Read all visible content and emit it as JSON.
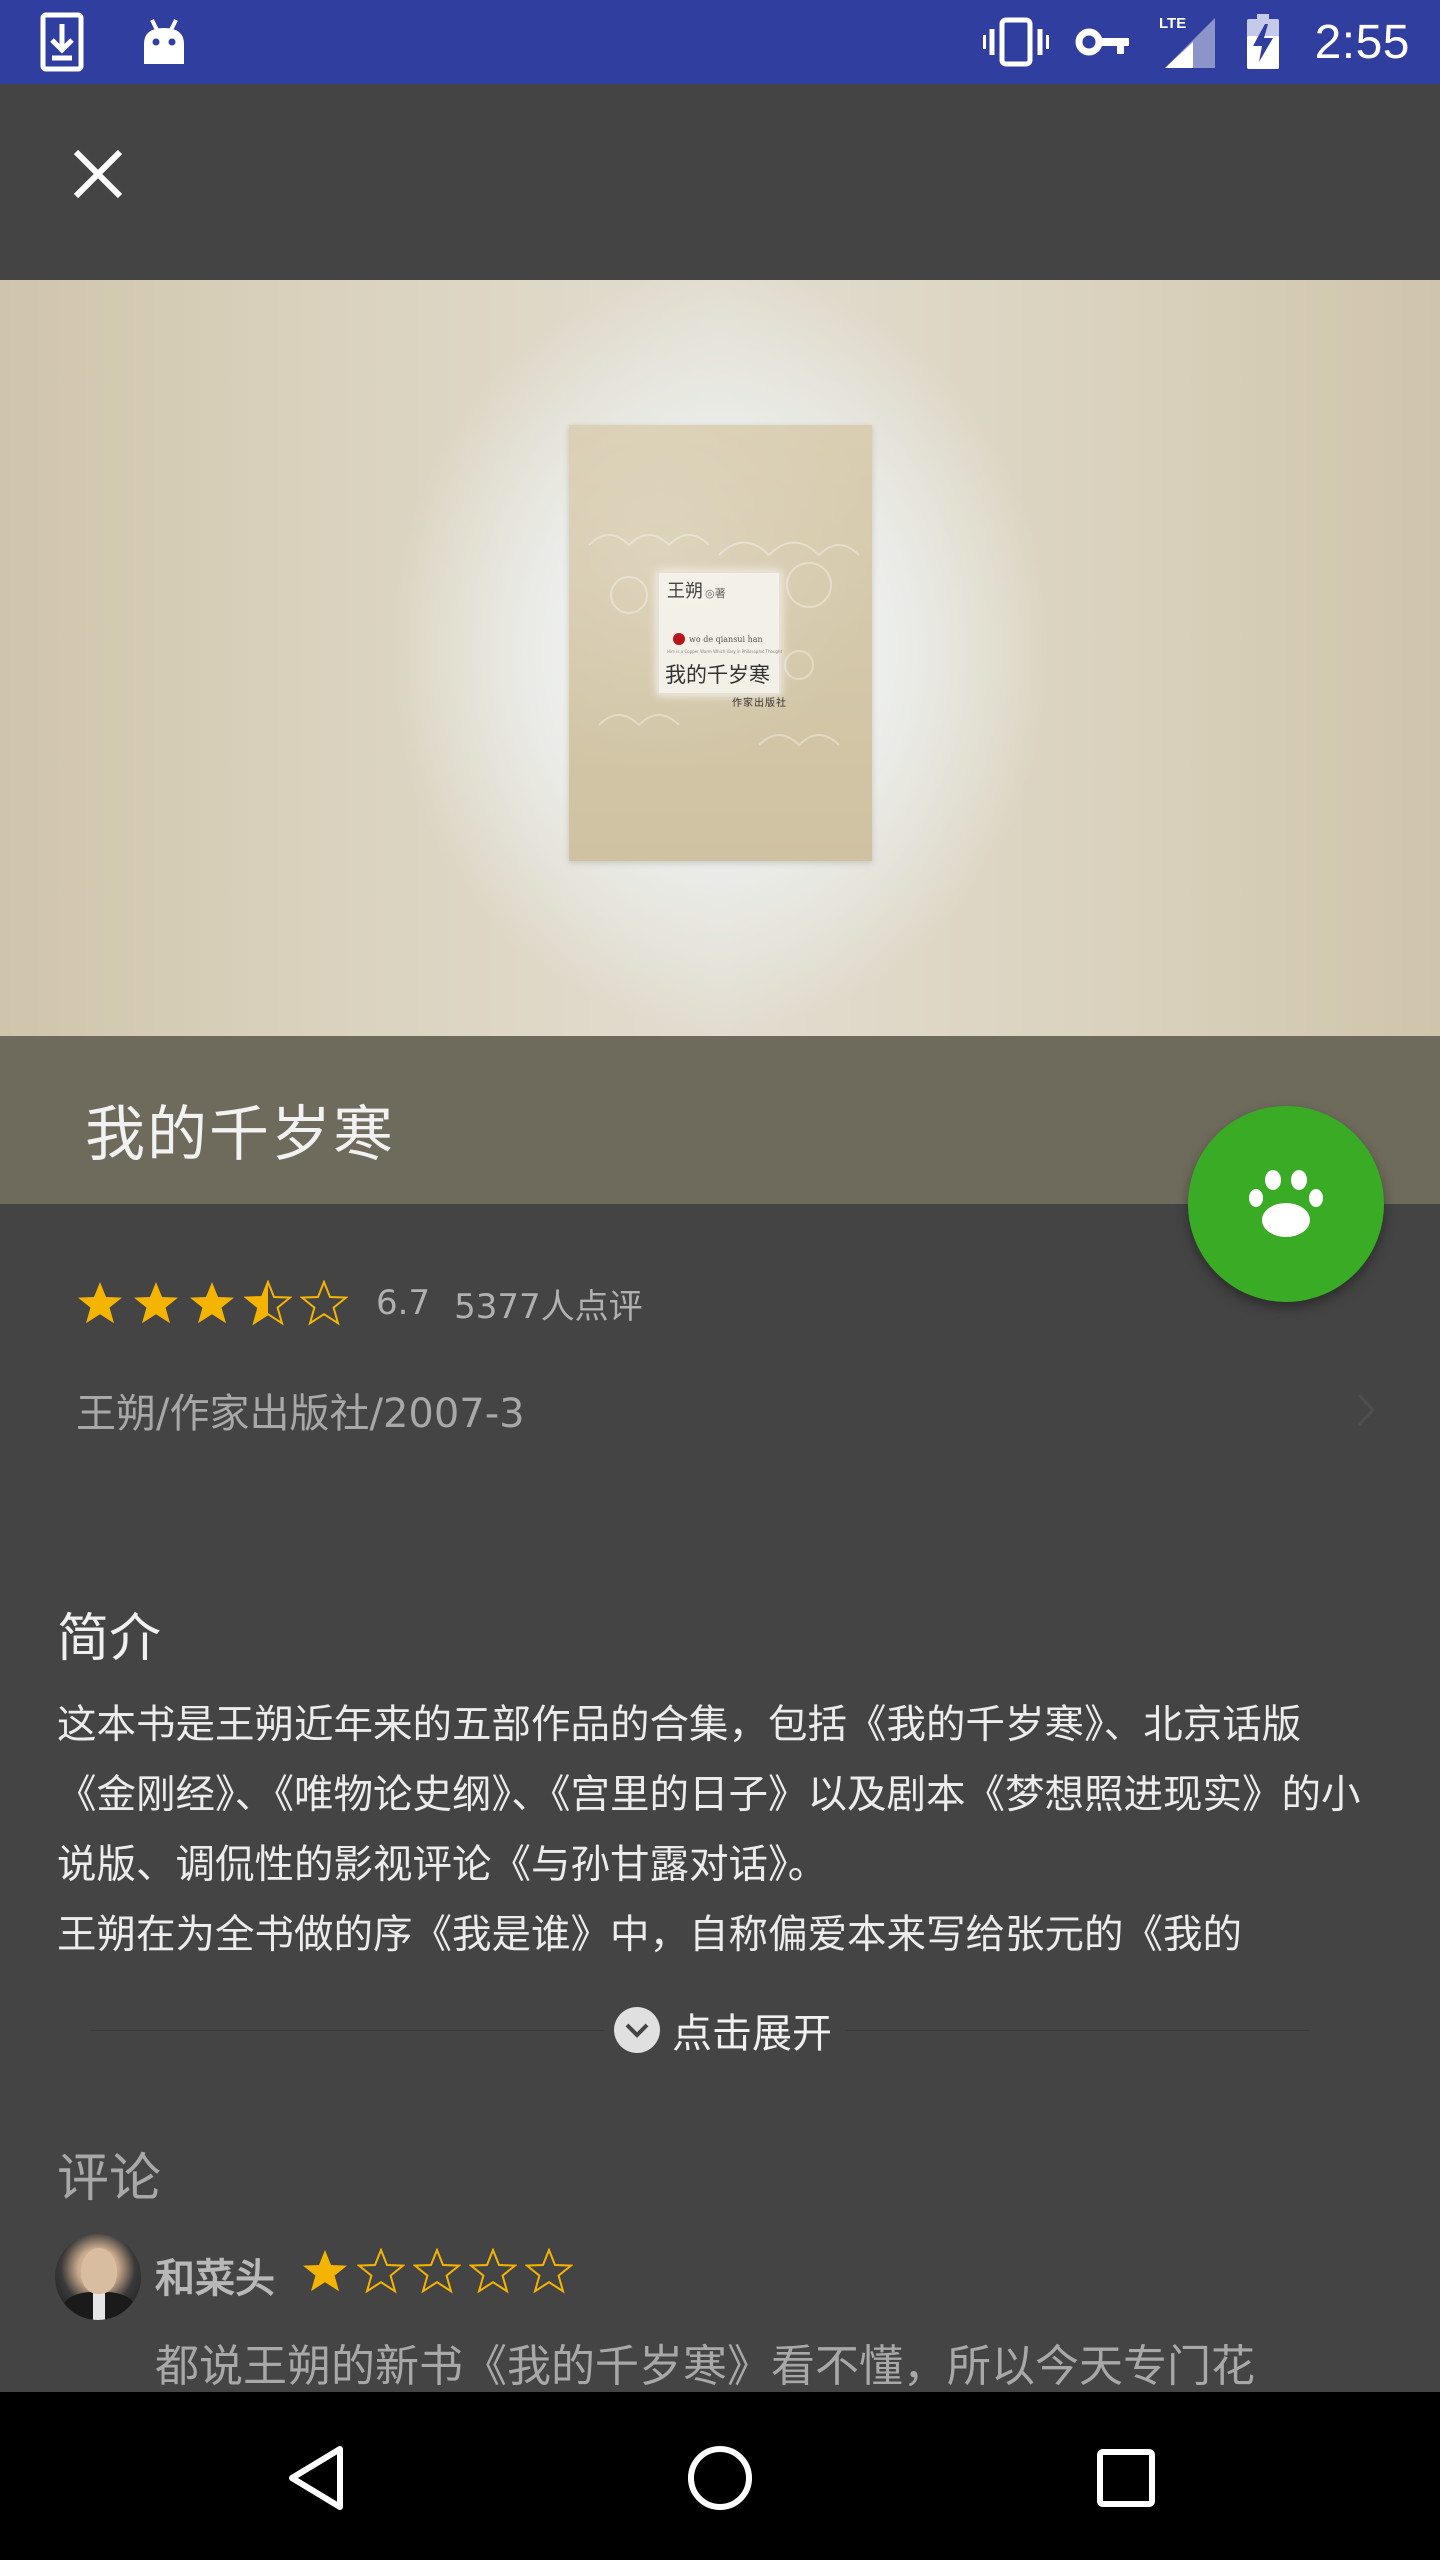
{
  "status_bar": {
    "time": "2:55",
    "network_type": "LTE",
    "icons": [
      "download-icon",
      "android-icon",
      "vibrate-icon",
      "vpn-key-icon",
      "lte-signal-icon",
      "battery-charging-icon"
    ],
    "background_color": "#303f9f"
  },
  "toolbar": {
    "close_icon": "close-icon"
  },
  "book": {
    "title": "我的千岁寒",
    "cover": {
      "author": "王朔",
      "author_suffix": "◎著",
      "pinyin": "wo de qiansui han",
      "subtitle": "Him is a Copper Warm Which Vary in Philosophic Thought",
      "title": "我的千岁寒",
      "publisher": "作家出版社"
    },
    "rating": {
      "score": "6.7",
      "stars": 3.5,
      "max_stars": 5,
      "count_text": "5377人点评"
    },
    "meta": "王朔/作家出版社/2007-3"
  },
  "fab": {
    "icon": "paw-icon",
    "color": "#3aab24"
  },
  "intro": {
    "heading": "简介",
    "body": "这本书是王朔近年来的五部作品的合集，包括《我的千岁寒》、北京话版《金刚经》、《唯物论史纲》、《宫里的日子》以及剧本《梦想照进现实》的小说版、调侃性的影视评论《与孙甘露对话》。\n王朔在为全书做的序《我是谁》中，自称偏爱本来写给张元的《我的",
    "expand_label": "点击展开"
  },
  "comments": {
    "heading": "评论",
    "items": [
      {
        "user": "和菜头",
        "stars": 1,
        "max_stars": 5,
        "text": "都说王朔的新书《我的千岁寒》看不懂，所以今天专门花"
      }
    ]
  },
  "nav": {
    "icons": [
      "back-icon",
      "home-icon",
      "recents-icon"
    ]
  },
  "colors": {
    "accent_star": "#f4b400",
    "page_background": "#444444",
    "title_band": "#6e6a5c"
  }
}
